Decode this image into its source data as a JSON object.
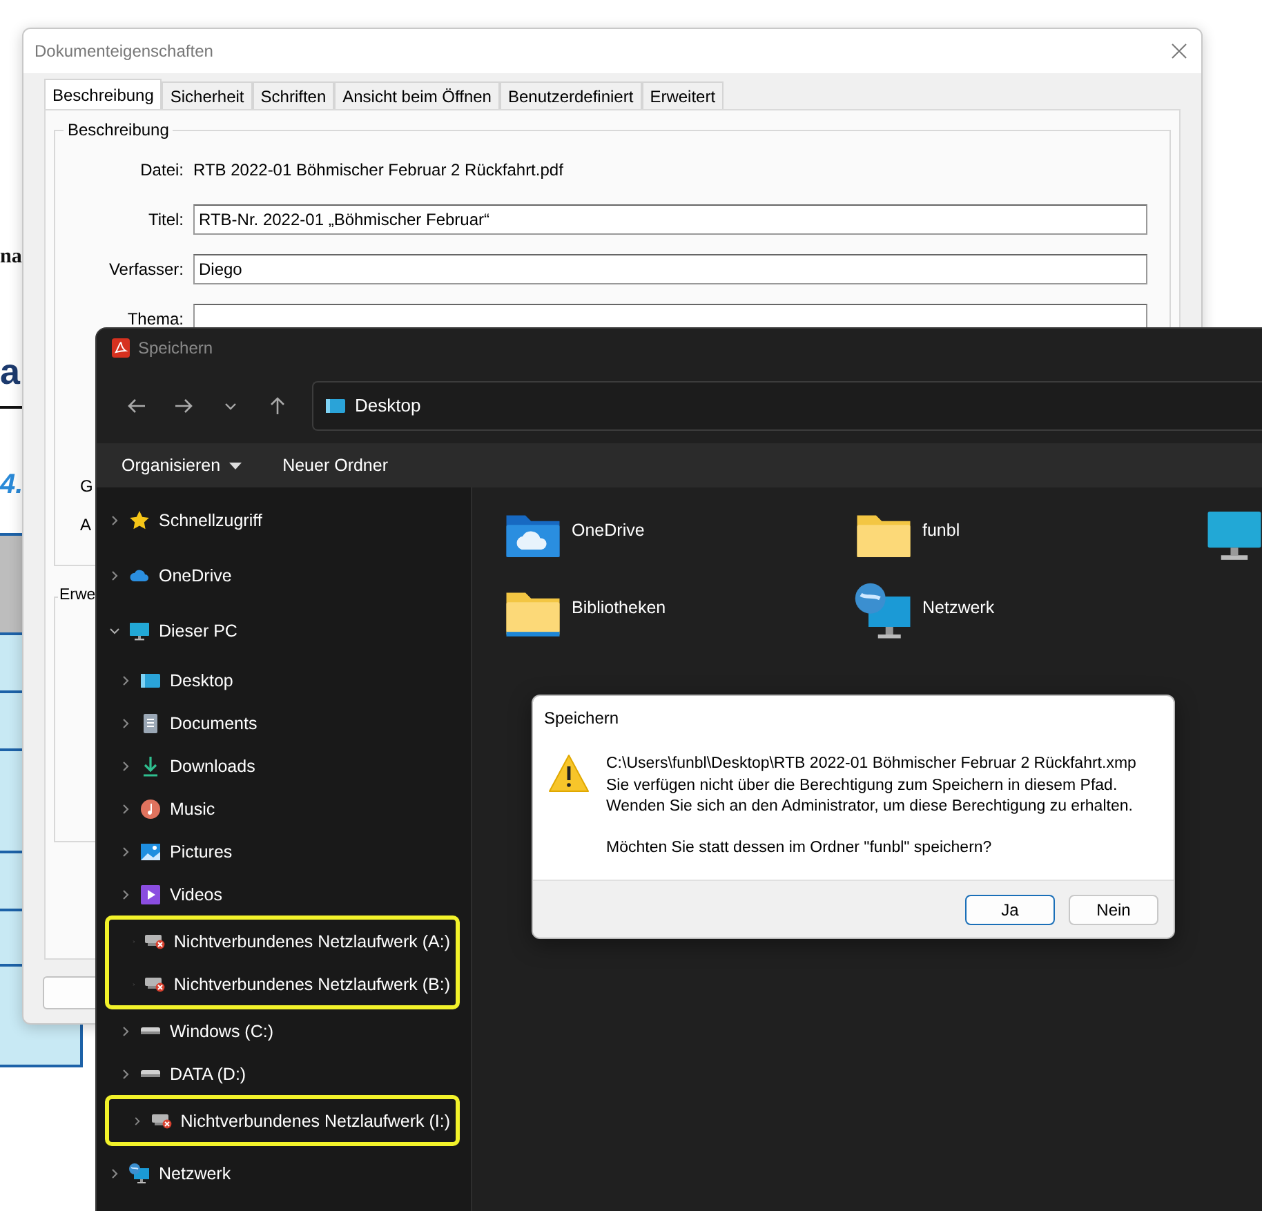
{
  "background_document": {
    "fragments": [
      {
        "kind": "serif",
        "text": "na"
      },
      {
        "kind": "heading",
        "text": "a"
      },
      {
        "kind": "italic",
        "text": "4."
      }
    ]
  },
  "properties_dialog": {
    "title": "Dokumenteigenschaften",
    "tabs": [
      {
        "label": "Beschreibung",
        "selected": true
      },
      {
        "label": "Sicherheit",
        "selected": false
      },
      {
        "label": "Schriften",
        "selected": false
      },
      {
        "label": "Ansicht beim Öffnen",
        "selected": false
      },
      {
        "label": "Benutzerdefiniert",
        "selected": false
      },
      {
        "label": "Erweitert",
        "selected": false
      }
    ],
    "group_title": "Beschreibung",
    "fields": [
      {
        "kind": "text",
        "label": "Datei:",
        "value": "RTB 2022-01 Böhmischer Februar 2 Rückfahrt.pdf"
      },
      {
        "kind": "input",
        "label": "Titel:",
        "value": "RTB-Nr. 2022-01 „Böhmischer Februar“"
      },
      {
        "kind": "input",
        "label": "Verfasser:",
        "value": "Diego"
      },
      {
        "kind": "input",
        "label": "Thema:"
      }
    ],
    "partial_labels": [
      "G",
      "A"
    ],
    "second_group_title": "Erwe"
  },
  "save_dialog": {
    "title": "Speichern",
    "address": "Desktop",
    "commands": [
      {
        "label": "Organisieren",
        "dropdown": true
      },
      {
        "label": "Neuer Ordner",
        "dropdown": false
      }
    ],
    "nav": [
      {
        "label": "Schnellzugriff",
        "kind": "star",
        "expanded": false,
        "highlighted": false
      },
      {
        "label": "OneDrive",
        "kind": "cloud",
        "expanded": false,
        "highlighted": false
      },
      {
        "label": "Dieser PC",
        "kind": "monitor",
        "expanded": true,
        "highlighted": false,
        "children": [
          {
            "label": "Desktop",
            "kind": "desktop",
            "expanded": false,
            "highlighted": false
          },
          {
            "label": "Documents",
            "kind": "document",
            "expanded": false,
            "highlighted": false
          },
          {
            "label": "Downloads",
            "kind": "download",
            "expanded": false,
            "highlighted": false
          },
          {
            "label": "Music",
            "kind": "music",
            "expanded": false,
            "highlighted": false
          },
          {
            "label": "Pictures",
            "kind": "pictures",
            "expanded": false,
            "highlighted": false
          },
          {
            "label": "Videos",
            "kind": "videos",
            "expanded": false,
            "highlighted": false
          },
          {
            "label": "Nichtverbundenes Netzlaufwerk (A:)",
            "kind": "netdrive",
            "expanded": false,
            "highlighted": true
          },
          {
            "label": "Nichtverbundenes Netzlaufwerk (B:)",
            "kind": "netdrive",
            "expanded": false,
            "highlighted": true
          },
          {
            "label": "Windows (C:)",
            "kind": "drive",
            "expanded": false,
            "highlighted": false
          },
          {
            "label": "DATA (D:)",
            "kind": "drive",
            "expanded": false,
            "highlighted": false
          },
          {
            "label": "Nichtverbundenes Netzlaufwerk (I:)",
            "kind": "netdrive",
            "expanded": false,
            "highlighted": true
          }
        ]
      },
      {
        "label": "Netzwerk",
        "kind": "network",
        "expanded": false,
        "highlighted": false
      }
    ],
    "items": [
      {
        "label": "OneDrive",
        "kind": "cloudfolder"
      },
      {
        "label": "funbl",
        "kind": "folder"
      },
      {
        "kind": "monitor"
      },
      {
        "label": "Bibliotheken",
        "kind": "libfolder"
      },
      {
        "label": "Netzwerk",
        "kind": "network"
      }
    ]
  },
  "message_box": {
    "title": "Speichern",
    "lines": [
      "C:\\Users\\funbl\\Desktop\\RTB 2022-01 Böhmischer Februar 2 Rückfahrt.xmp",
      "Sie verfügen nicht über die Berechtigung zum Speichern in diesem Pfad.",
      "Wenden Sie sich an den Administrator, um diese Berechtigung zu erhalten."
    ],
    "question": "Möchten Sie statt dessen im Ordner \"funbl\" speichern?",
    "buttons": [
      {
        "label": "Ja",
        "selected": true
      },
      {
        "label": "Nein",
        "selected": false
      }
    ]
  }
}
